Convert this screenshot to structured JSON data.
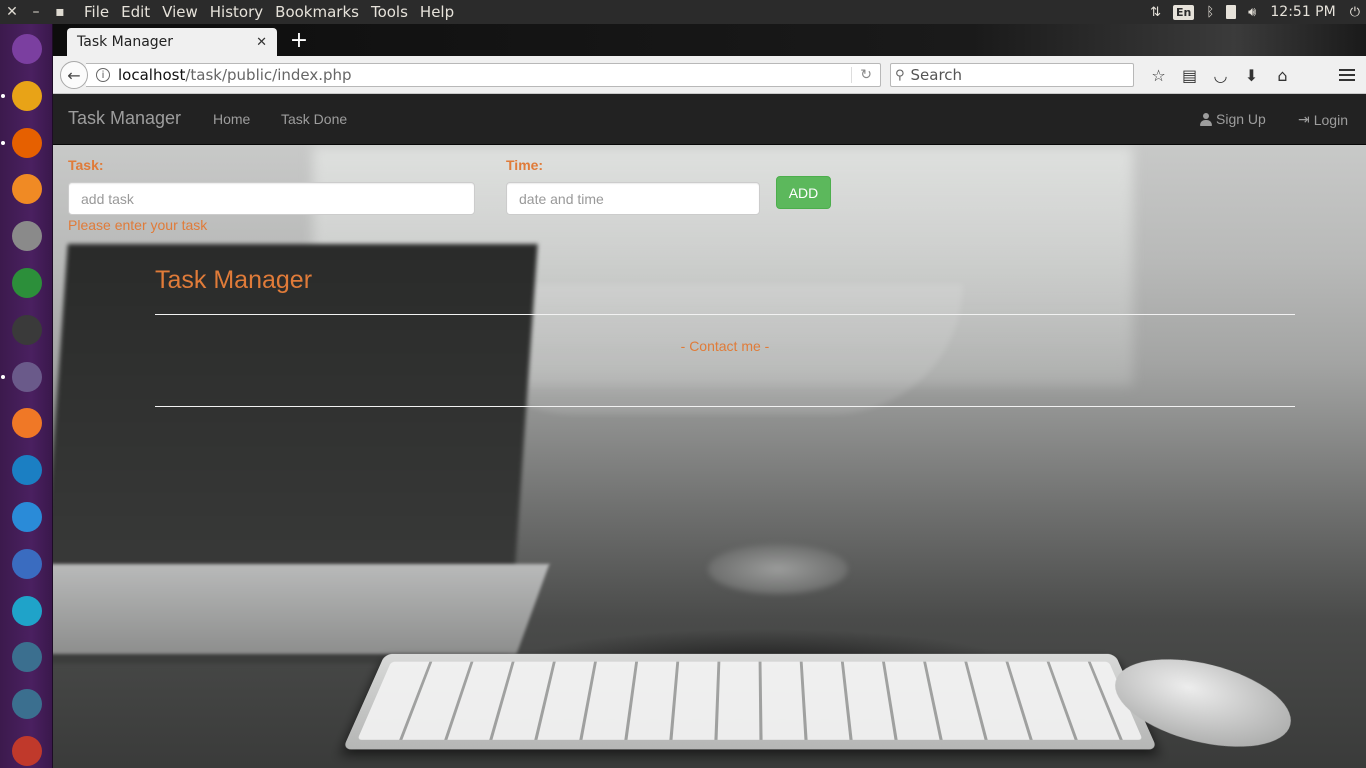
{
  "top_panel": {
    "menus": [
      "File",
      "Edit",
      "View",
      "History",
      "Bookmarks",
      "Tools",
      "Help"
    ],
    "language": "En",
    "clock": "12:51 PM"
  },
  "launcher": {
    "apps": [
      {
        "name": "ubuntu-dash",
        "color": "#7b3fa0"
      },
      {
        "name": "files",
        "color": "#e8a317"
      },
      {
        "name": "firefox",
        "color": "#e66000"
      },
      {
        "name": "software-center",
        "color": "#f08a24"
      },
      {
        "name": "settings",
        "color": "#8a8a8a"
      },
      {
        "name": "chrome",
        "color": "#2c8f3a"
      },
      {
        "name": "terminal",
        "color": "#3a3a3a"
      },
      {
        "name": "atom",
        "color": "#6a5a8a"
      },
      {
        "name": "orange-app",
        "color": "#f07826"
      },
      {
        "name": "app-blue",
        "color": "#1b7fc3"
      },
      {
        "name": "app-dots",
        "color": "#2a8bd8"
      },
      {
        "name": "app-pen",
        "color": "#3a6cc0"
      },
      {
        "name": "update",
        "color": "#1fa3c9"
      },
      {
        "name": "app-q1",
        "color": "#3b6f8f"
      },
      {
        "name": "app-q2",
        "color": "#3b6f8f"
      },
      {
        "name": "app-trash",
        "color": "#c0392b"
      }
    ]
  },
  "browser": {
    "tab_title": "Task Manager",
    "url_host": "localhost",
    "url_path": "/task/public/index.php",
    "search_placeholder": "Search"
  },
  "site": {
    "brand": "Task Manager",
    "nav": {
      "home": "Home",
      "task_done": "Task Done",
      "sign_up": "Sign Up",
      "login": "Login"
    },
    "form": {
      "task_label": "Task:",
      "task_placeholder": "add task",
      "time_label": "Time:",
      "time_placeholder": "date and time",
      "add_button": "ADD",
      "task_error": "Please enter your task"
    },
    "heading": "Task Manager",
    "contact": "- Contact me -"
  },
  "colors": {
    "accent": "#e07b39",
    "navbar": "#222222",
    "success": "#5cb85c"
  }
}
